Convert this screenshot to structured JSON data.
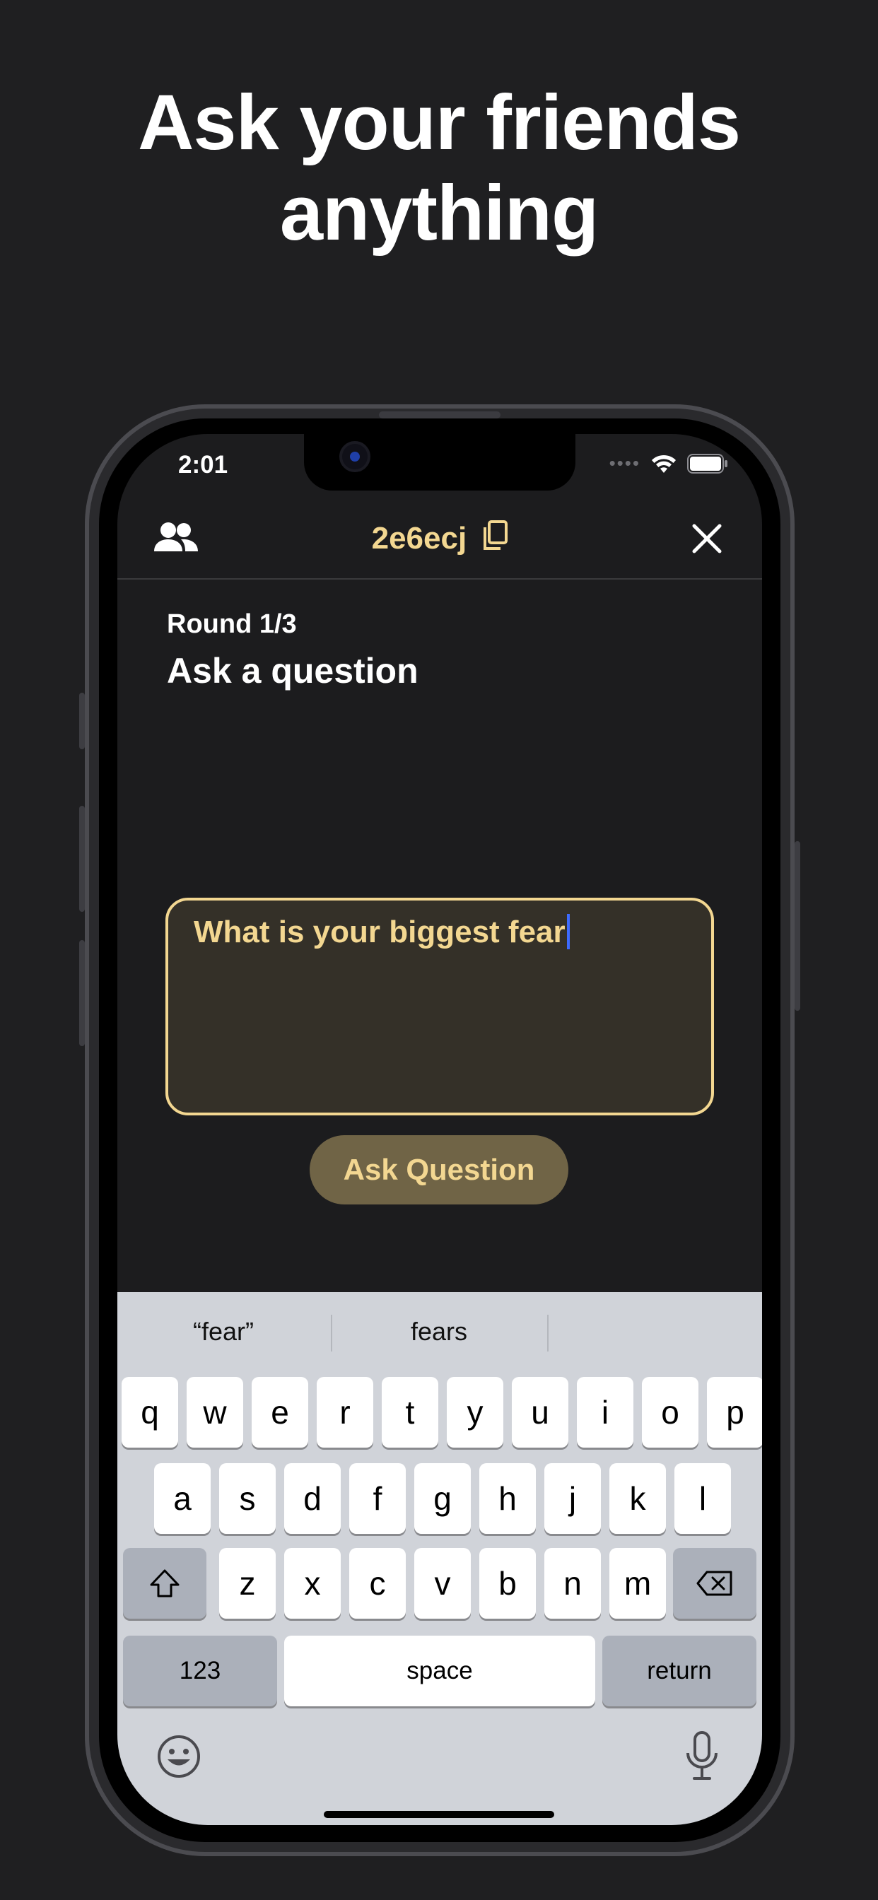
{
  "headline": {
    "line1": "Ask your friends",
    "line2": "anything"
  },
  "status_bar": {
    "time": "2:01"
  },
  "nav": {
    "room_code": "2e6ecj"
  },
  "content": {
    "round": "Round 1/3",
    "title": "Ask a question",
    "question_value": "What is your biggest fear",
    "ask_button": "Ask Question"
  },
  "keyboard": {
    "suggestions": [
      "“fear”",
      "fears",
      ""
    ],
    "row1": [
      "q",
      "w",
      "e",
      "r",
      "t",
      "y",
      "u",
      "i",
      "o",
      "p"
    ],
    "row2": [
      "a",
      "s",
      "d",
      "f",
      "g",
      "h",
      "j",
      "k",
      "l"
    ],
    "row3": [
      "z",
      "x",
      "c",
      "v",
      "b",
      "n",
      "m"
    ],
    "numbers_key": "123",
    "space_key": "space",
    "return_key": "return"
  },
  "colors": {
    "accent": "#f3d791",
    "background": "#1c1c1e",
    "button_bg": "#706446",
    "input_bg": "#343028"
  }
}
